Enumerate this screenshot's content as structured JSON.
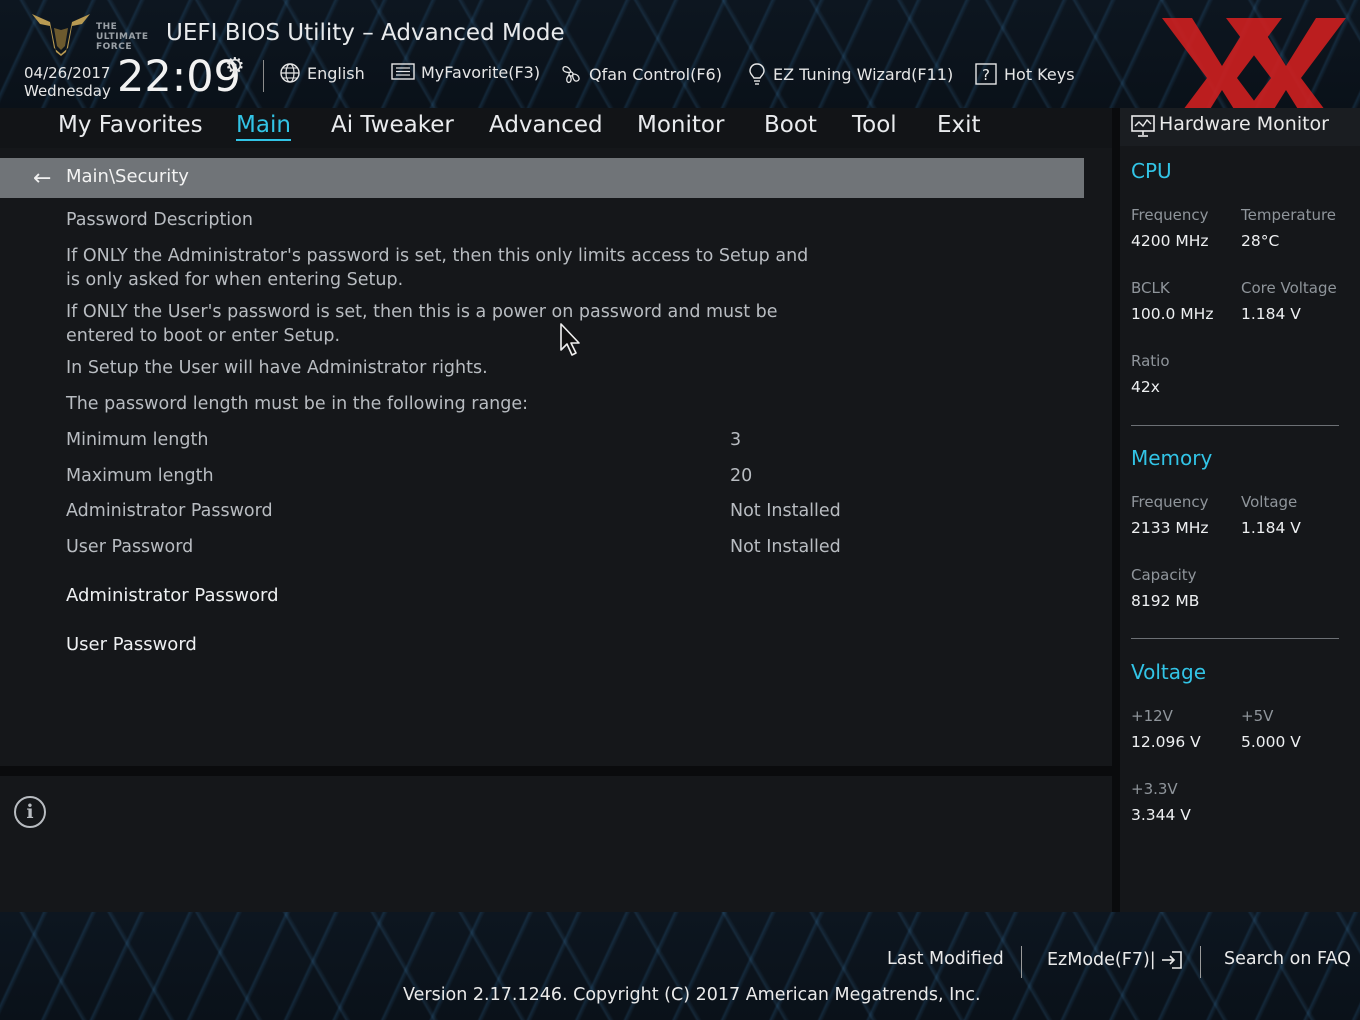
{
  "header": {
    "logo_text": [
      "THE",
      "ULTIMATE",
      "FORCE"
    ],
    "title": "UEFI BIOS Utility – Advanced Mode",
    "date": "04/26/2017",
    "weekday": "Wednesday",
    "time": "22:09",
    "tools": [
      {
        "label": "English",
        "icon": "globe-icon"
      },
      {
        "label": "MyFavorite(F3)",
        "icon": "favorite-list-icon"
      },
      {
        "label": "Qfan Control(F6)",
        "icon": "fan-icon"
      },
      {
        "label": "EZ Tuning Wizard(F11)",
        "icon": "lightbulb-icon"
      },
      {
        "label": "Hot Keys",
        "icon": "question-box-icon"
      }
    ]
  },
  "nav": {
    "tabs": [
      "My Favorites",
      "Main",
      "Ai Tweaker",
      "Advanced",
      "Monitor",
      "Boot",
      "Tool",
      "Exit"
    ],
    "active": "Main"
  },
  "breadcrumb": "Main\\Security",
  "content": {
    "description_title": "Password Description",
    "paragraphs": [
      [
        "If ONLY the Administrator's password is set, then this only limits access to Setup and",
        "is only asked for when entering Setup."
      ],
      [
        "If ONLY the User's password is set, then this is a power on password and must be",
        "entered to boot or enter Setup."
      ],
      [
        "In Setup the User will have Administrator rights."
      ],
      [
        "The password length must be in the following range:"
      ]
    ],
    "rows": [
      {
        "label": "Minimum length",
        "value": "3"
      },
      {
        "label": "Maximum length",
        "value": "20"
      },
      {
        "label": "Administrator Password",
        "value": "Not Installed"
      },
      {
        "label": "User Password",
        "value": "Not Installed"
      }
    ],
    "actions": [
      "Administrator Password",
      "User Password"
    ]
  },
  "hardware_monitor": {
    "title": "Hardware Monitor",
    "cpu": {
      "section": "CPU",
      "frequency_label": "Frequency",
      "frequency": "4200 MHz",
      "temperature_label": "Temperature",
      "temperature": "28°C",
      "bclk_label": "BCLK",
      "bclk": "100.0 MHz",
      "core_voltage_label": "Core Voltage",
      "core_voltage": "1.184 V",
      "ratio_label": "Ratio",
      "ratio": "42x"
    },
    "memory": {
      "section": "Memory",
      "frequency_label": "Frequency",
      "frequency": "2133 MHz",
      "voltage_label": "Voltage",
      "voltage": "1.184 V",
      "capacity_label": "Capacity",
      "capacity": "8192 MB"
    },
    "voltage": {
      "section": "Voltage",
      "v12_label": "+12V",
      "v12": "12.096 V",
      "v5_label": "+5V",
      "v5": "5.000 V",
      "v33_label": "+3.3V",
      "v33": "3.344 V"
    }
  },
  "footer": {
    "last_modified": "Last Modified",
    "ezmode": "EzMode(F7)|",
    "search_faq": "Search on FAQ",
    "version": "Version 2.17.1246. Copyright (C) 2017 American Megatrends, Inc."
  },
  "colors": {
    "accent": "#32c4e6",
    "watermark": "#d42020"
  }
}
